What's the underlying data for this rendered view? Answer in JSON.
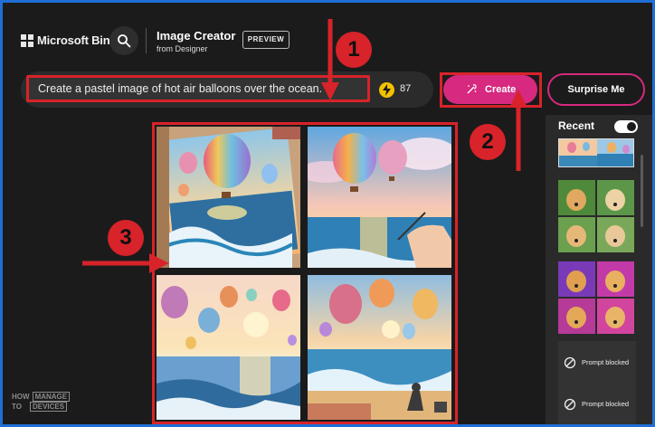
{
  "header": {
    "brand": "Microsoft Bing",
    "product_title": "Image Creator",
    "product_sub": "from Designer",
    "preview_badge": "PREVIEW"
  },
  "prompt": {
    "value": "Create a pastel image of hot air balloons over the ocean.",
    "coins": "87"
  },
  "buttons": {
    "create": "Create",
    "surprise": "Surprise Me"
  },
  "recent": {
    "title": "Recent",
    "toggle_on": true,
    "blocked": [
      "Prompt blocked",
      "Prompt blocked"
    ]
  },
  "annotations": [
    "1",
    "2",
    "3"
  ],
  "watermark": {
    "line1a": "HOW",
    "line1b": "MANAGE",
    "line2a": "TO",
    "line2b": "DEVICES"
  },
  "colors": {
    "accent": "#d6297f",
    "highlight": "#d8232a",
    "frame": "#1f6fd6",
    "background": "#1b1b1b"
  }
}
